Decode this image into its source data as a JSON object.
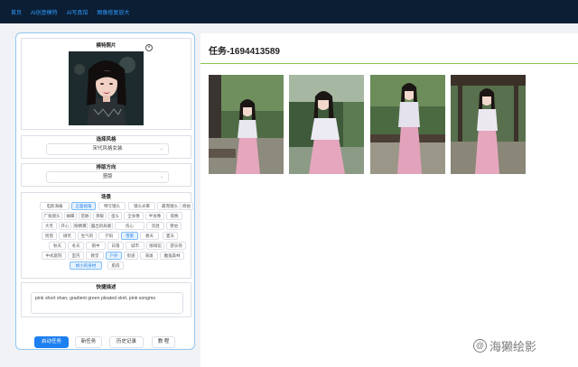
{
  "nav": {
    "items": [
      "首页",
      "AI创意模特",
      "AI写真馆",
      "图像修复放大"
    ]
  },
  "panel": {
    "photo_section_title": "模特照片",
    "close_symbol": "×",
    "style_section_title": "选择风格",
    "style_value": "宋代风格女装",
    "direction_section_title": "排版方向",
    "direction_value": "竖版",
    "scene_section_title": "场景",
    "scene_tags": [
      {
        "label": "电影海报",
        "active": false
      },
      {
        "label": "正面视角",
        "active": true
      },
      {
        "label": "特写镜头",
        "active": false
      },
      {
        "label": "镜头光晕",
        "active": false
      },
      {
        "label": "最而镜头",
        "active": false
      },
      {
        "label": "俯拍",
        "active": false
      },
      {
        "label": "广角镜头",
        "active": false
      },
      {
        "label": "蝴蝶",
        "active": false
      },
      {
        "label": "苗脉",
        "active": false
      },
      {
        "label": "蒸暖",
        "active": false
      },
      {
        "label": "蛋头",
        "active": false
      },
      {
        "label": "全身像",
        "active": false
      },
      {
        "label": "半身像",
        "active": false
      },
      {
        "label": "夜晚",
        "active": false
      },
      {
        "label": "大笑",
        "active": false
      },
      {
        "label": "开心",
        "active": false
      },
      {
        "label": "眼睛雾",
        "active": false
      },
      {
        "label": "露出的肩膀",
        "active": false
      },
      {
        "label": "伤心",
        "active": false
      },
      {
        "label": "流泪",
        "active": false
      },
      {
        "label": "害怕",
        "active": false
      },
      {
        "label": "愤怒",
        "active": false
      },
      {
        "label": "微笑",
        "active": false
      },
      {
        "label": "生气的",
        "active": false
      },
      {
        "label": "夕阳",
        "active": false
      },
      {
        "label": "雪景",
        "active": true
      },
      {
        "label": "春天",
        "active": false
      },
      {
        "label": "夏天",
        "active": false
      },
      {
        "label": "秋天",
        "active": false
      },
      {
        "label": "冬天",
        "active": false
      },
      {
        "label": "雨中",
        "active": false
      },
      {
        "label": "日落",
        "active": false
      },
      {
        "label": "城市",
        "active": false
      },
      {
        "label": "咖啡馆",
        "active": false
      },
      {
        "label": "游乐场",
        "active": false
      },
      {
        "label": "中式庭院",
        "active": false
      },
      {
        "label": "室内",
        "active": false
      },
      {
        "label": "教堂",
        "active": false
      },
      {
        "label": "户外",
        "active": true
      },
      {
        "label": "街道",
        "active": false
      },
      {
        "label": "海滩",
        "active": false
      },
      {
        "label": "魔鬼森林",
        "active": false
      },
      {
        "label": "娇小的身材",
        "active": true
      },
      {
        "label": "肌肉",
        "active": false
      }
    ],
    "desc_section_title": "快捷描述",
    "desc_value": "pink short shan, gradient green pleated skirt, pink songmo",
    "buttons": {
      "start": "启动任务",
      "new": "新任务",
      "history": "历史记录",
      "tutorial": "教 程"
    }
  },
  "main": {
    "task_title": "任务-1694413589"
  },
  "watermark": {
    "text": "海獭绘影"
  },
  "colors": {
    "nav_bg": "#0b1e33",
    "accent": "#1e7ff0",
    "rule": "#8bc34a"
  }
}
